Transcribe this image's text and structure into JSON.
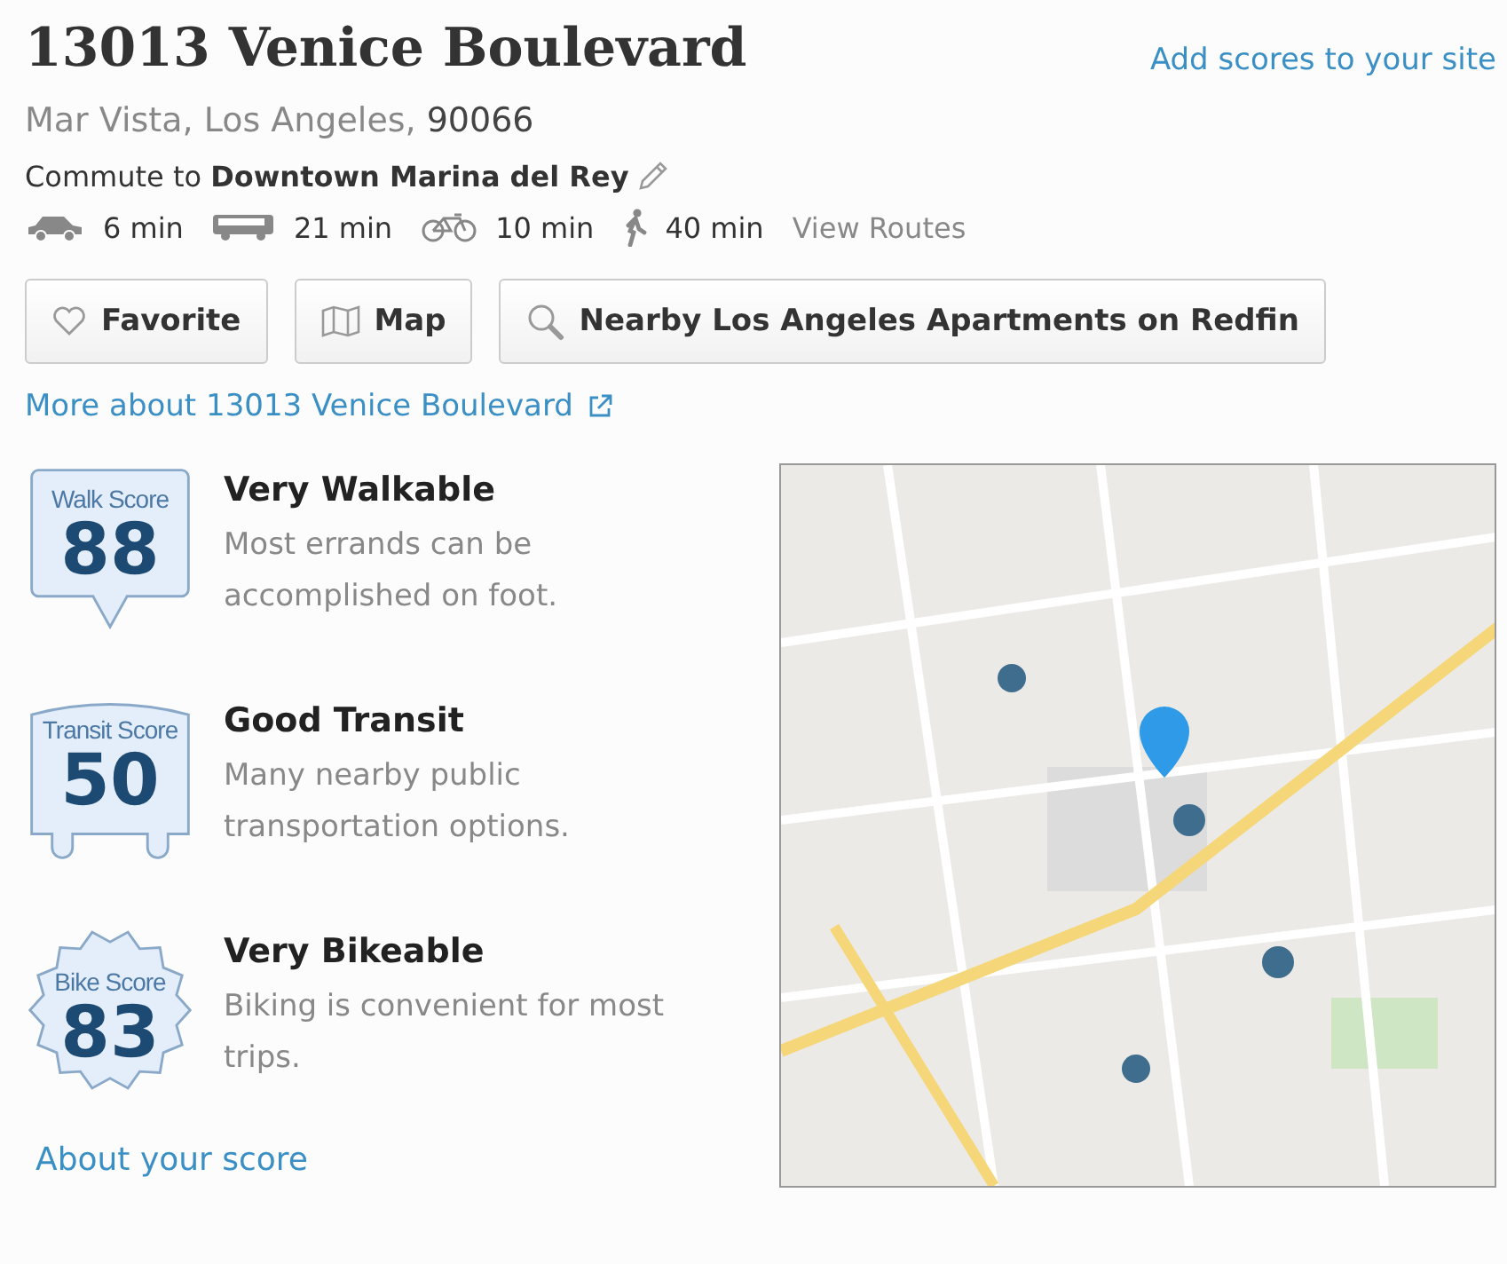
{
  "title": "13013 Venice Boulevard",
  "site_link": "Add scores to your site",
  "locality": "Mar Vista, Los Angeles,",
  "zip": "90066",
  "commute": {
    "prefix": "Commute to",
    "destination": "Downtown Marina del Rey"
  },
  "modes": [
    {
      "kind": "car",
      "time": "6 min"
    },
    {
      "kind": "bus",
      "time": "21 min"
    },
    {
      "kind": "bike",
      "time": "10 min"
    },
    {
      "kind": "walk",
      "time": "40 min"
    }
  ],
  "view_routes": "View Routes",
  "buttons": [
    {
      "kind": "favorite",
      "label": "Favorite"
    },
    {
      "kind": "map",
      "label": "Map"
    },
    {
      "kind": "search",
      "label": "Nearby Los Angeles Apartments on Redfin"
    }
  ],
  "more_link": "More about 13013 Venice Boulevard",
  "scores": [
    {
      "kind": "walk",
      "label": "Walk Score",
      "value": "88",
      "heading": "Very Walkable",
      "description": "Most errands can be accomplished on foot."
    },
    {
      "kind": "transit",
      "label": "Transit Score",
      "value": "50",
      "heading": "Good Transit",
      "description": "Many nearby public transportation options."
    },
    {
      "kind": "bike",
      "label": "Bike Score",
      "value": "83",
      "heading": "Very Bikeable",
      "description": "Biking is convenient for most trips."
    }
  ],
  "about_link": "About your score"
}
